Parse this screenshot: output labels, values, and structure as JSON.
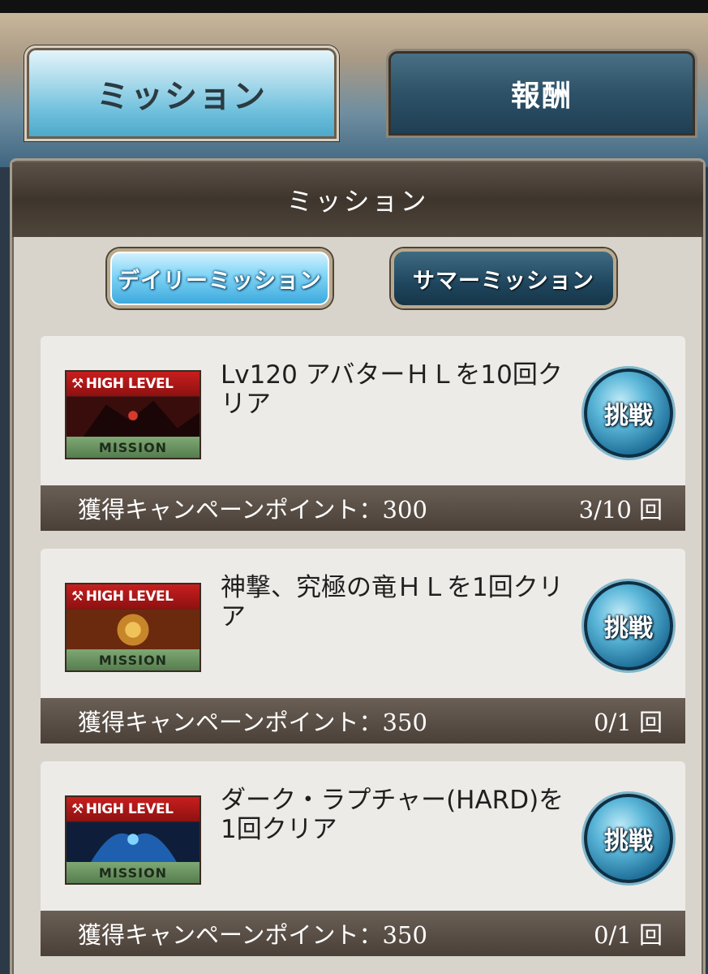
{
  "tabs": [
    {
      "label": "ミッション",
      "active": true
    },
    {
      "label": "報酬",
      "active": false
    }
  ],
  "panel": {
    "title": "ミッション"
  },
  "subtabs": [
    {
      "label": "デイリーミッション",
      "active": true
    },
    {
      "label": "サマーミッション",
      "active": false
    }
  ],
  "missions": [
    {
      "badge_top": "HIGH LEVEL",
      "badge_bottom": "MISSION",
      "title": "Lv120 アバターＨＬを10回クリア",
      "button": "挑戦",
      "points": "獲得キャンペーンポイント：300",
      "progress": "3/10 回"
    },
    {
      "badge_top": "HIGH LEVEL",
      "badge_bottom": "MISSION",
      "title": "神撃、究極の竜ＨＬを1回クリア",
      "button": "挑戦",
      "points": "獲得キャンペーンポイント：350",
      "progress": "0/1 回"
    },
    {
      "badge_top": "HIGH LEVEL",
      "badge_bottom": "MISSION",
      "title": "ダーク・ラプチャー(HARD)を1回クリア",
      "button": "挑戦",
      "points": "獲得キャンペーンポイント：350",
      "progress": "0/1 回"
    }
  ],
  "colors": {
    "tab_active": "#6fc0dc",
    "tab_inactive": "#2d5268",
    "card_bg": "#ecebe7",
    "footer_bg": "#4a4038",
    "badge_red": "#c81e1e",
    "button_blue": "#1f6f98"
  }
}
